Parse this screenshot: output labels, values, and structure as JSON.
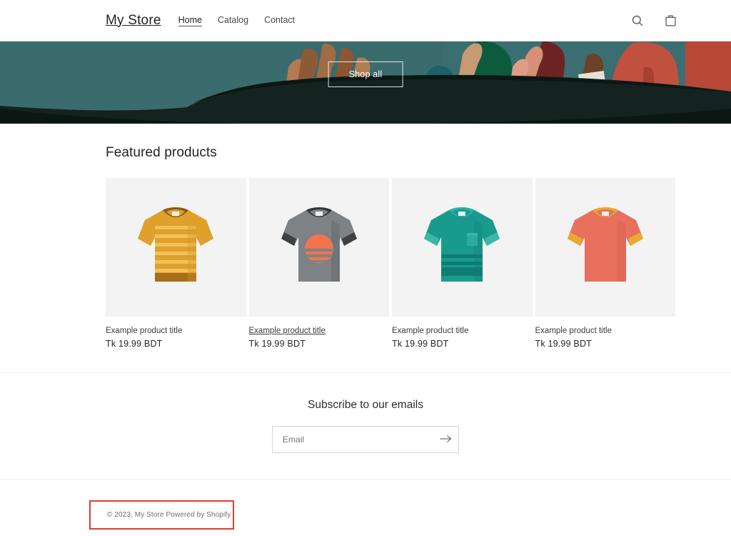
{
  "header": {
    "logo": "My Store",
    "nav": [
      {
        "label": "Home",
        "active": true
      },
      {
        "label": "Catalog",
        "active": false
      },
      {
        "label": "Contact",
        "active": false
      }
    ],
    "search_icon": "search-icon",
    "cart_icon": "shopping-bag-icon"
  },
  "hero": {
    "button_label": "Shop all",
    "background_color": "#3b6e70",
    "boat_color": "#10201c",
    "alt": "Illustration of people in a boat"
  },
  "featured": {
    "title": "Featured products",
    "products": [
      {
        "title": "Example product title",
        "price": "Tk 19.99 BDT",
        "hovered": false,
        "image": "striped-orange-tshirt",
        "colors": {
          "body": "#e0a02c",
          "stripe": "#f0bb55",
          "trim": "#9e6b1d"
        }
      },
      {
        "title": "Example product title",
        "price": "Tk 19.99 BDT",
        "hovered": true,
        "image": "gray-sunset-graphic-tshirt",
        "colors": {
          "body": "#7e8184",
          "stripe": "#6d7174",
          "trim": "#3e4245",
          "graphic": "#f2744f"
        }
      },
      {
        "title": "Example product title",
        "price": "Tk 19.99 BDT",
        "hovered": false,
        "image": "teal-pocket-tshirt",
        "colors": {
          "body": "#1b9e90",
          "stripe": "#107b74",
          "trim": "#37b5a3",
          "graphic": "#2aa596"
        }
      },
      {
        "title": "Example product title",
        "price": "Tk 19.99 BDT",
        "hovered": false,
        "image": "coral-ringer-tshirt",
        "colors": {
          "body": "#e8705c",
          "stripe": "#dc6450",
          "trim": "#e9a92f",
          "graphic": "#e8705c"
        }
      }
    ]
  },
  "newsletter": {
    "title": "Subscribe to our emails",
    "placeholder": "Email",
    "value": "",
    "submit_icon": "arrow-right-icon"
  },
  "footer": {
    "copyright": "© 2023, My Store",
    "powered_by": "Powered by Shopify",
    "highlight_color": "#e03c2d"
  }
}
